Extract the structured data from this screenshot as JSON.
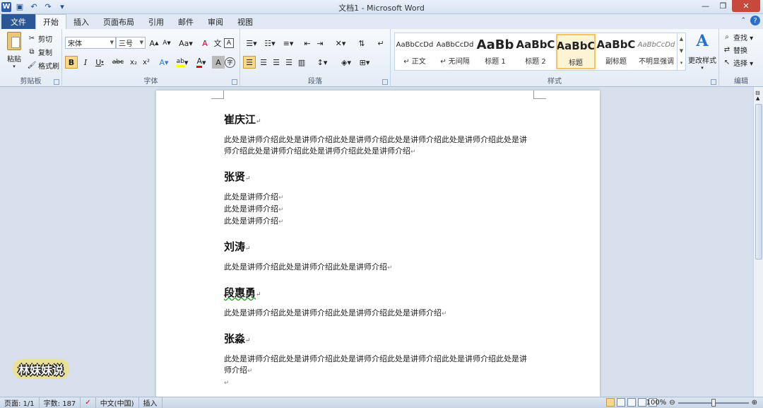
{
  "window": {
    "title": "文档1 - Microsoft Word"
  },
  "tabs": [
    "文件",
    "开始",
    "插入",
    "页面布局",
    "引用",
    "邮件",
    "审阅",
    "视图"
  ],
  "clipboard": {
    "paste": "粘贴",
    "cut": "剪切",
    "copy": "复制",
    "format_painter": "格式刷",
    "label": "剪贴板"
  },
  "font": {
    "name": "宋体",
    "size": "三号",
    "label": "字体",
    "bold": "B",
    "italic": "I",
    "underline": "U",
    "strike": "abc",
    "sub": "x₂",
    "sup": "x²",
    "grow": "A",
    "shrink": "A",
    "aa": "Aa",
    "clear": "A",
    "phonetic": "文",
    "border": "A",
    "char_shade": "A",
    "enclosed": "字"
  },
  "paragraph": {
    "label": "段落"
  },
  "styles": {
    "label": "样式",
    "items": [
      {
        "preview": "AaBbCcDd",
        "name": "↵ 正文"
      },
      {
        "preview": "AaBbCcDd",
        "name": "↵ 无间隔"
      },
      {
        "preview": "AaBb",
        "name": "标题 1"
      },
      {
        "preview": "AaBbC",
        "name": "标题 2"
      },
      {
        "preview": "AaBbC",
        "name": "标题"
      },
      {
        "preview": "AaBbC",
        "name": "副标题"
      },
      {
        "preview": "AaBbCcDd",
        "name": "不明显强调"
      }
    ],
    "change": "更改样式"
  },
  "editing": {
    "find": "查找 ▾",
    "replace": "替换",
    "select": "选择 ▾",
    "label": "编辑"
  },
  "document": {
    "sections": [
      {
        "name": "崔庆江",
        "lines": [
          "此处是讲师介绍此处是讲师介绍此处是讲师介绍此处是讲师介绍此处是讲师介绍此处是讲",
          "师介绍此处是讲师介绍此处是讲师介绍此处是讲师介绍"
        ]
      },
      {
        "name": "张贤",
        "lines": [
          "此处是讲师介绍",
          "此处是讲师介绍",
          "此处是讲师介绍"
        ]
      },
      {
        "name": "刘涛",
        "lines": [
          "此处是讲师介绍此处是讲师介绍此处是讲师介绍"
        ]
      },
      {
        "name": "段惠勇",
        "lines": [
          "此处是讲师介绍此处是讲师介绍此处是讲师介绍此处是讲师介绍"
        ]
      },
      {
        "name": "张淼",
        "lines": [
          "此处是讲师介绍此处是讲师介绍此处是讲师介绍此处是讲师介绍此处是讲师介绍此处是讲",
          "师介绍"
        ]
      }
    ],
    "para_mark": "↵"
  },
  "status": {
    "page": "页面: 1/1",
    "words": "字数: 187",
    "lang": "中文(中国)",
    "mode": "插入",
    "zoom": "100%"
  },
  "watermark": "林妹妹说"
}
